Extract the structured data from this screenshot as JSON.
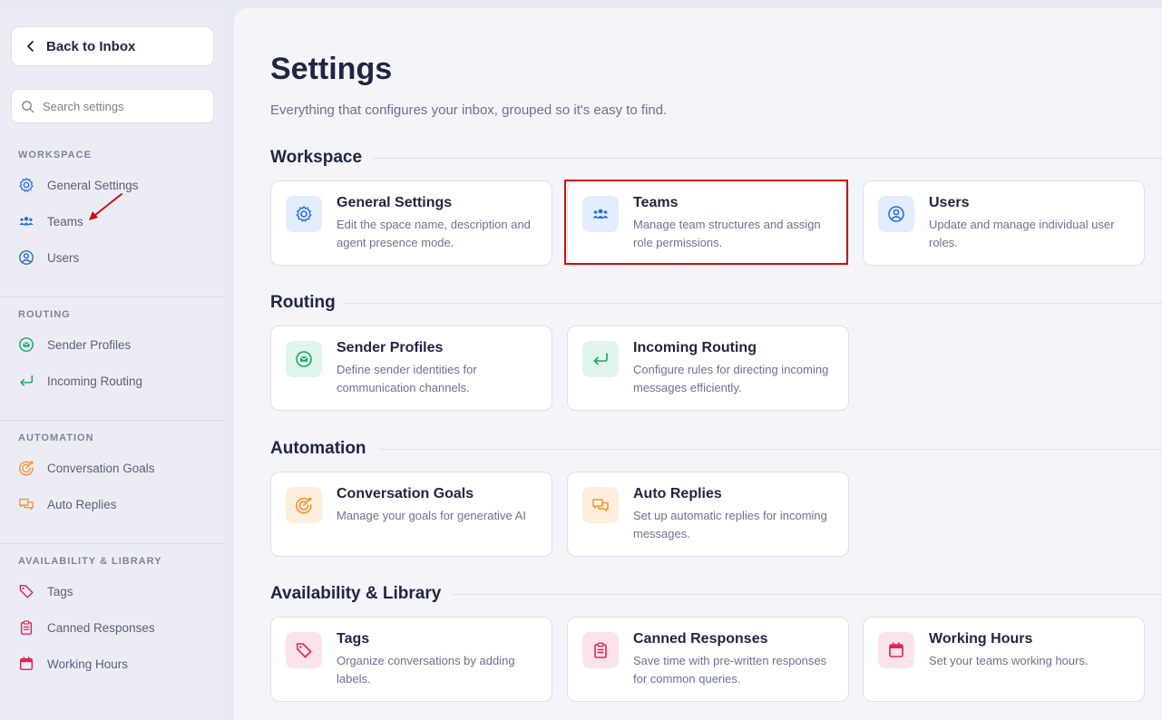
{
  "sidebar": {
    "back_label": "Back to Inbox",
    "search_placeholder": "Search settings",
    "groups": [
      {
        "title": "WORKSPACE",
        "items": [
          "General Settings",
          "Teams",
          "Users"
        ]
      },
      {
        "title": "ROUTING",
        "items": [
          "Sender Profiles",
          "Incoming Routing"
        ]
      },
      {
        "title": "AUTOMATION",
        "items": [
          "Conversation Goals",
          "Auto Replies"
        ]
      },
      {
        "title": "AVAILABILITY & LIBRARY",
        "items": [
          "Tags",
          "Canned Responses",
          "Working Hours"
        ]
      }
    ]
  },
  "main": {
    "title": "Settings",
    "subtitle": "Everything that configures your inbox, grouped so it's easy to find.",
    "sections": [
      {
        "title": "Workspace",
        "cards": [
          {
            "title": "General Settings",
            "desc": "Edit the space name, description and agent presence mode."
          },
          {
            "title": "Teams",
            "desc": "Manage team structures and assign role permissions."
          },
          {
            "title": "Users",
            "desc": "Update and manage individual user roles."
          }
        ]
      },
      {
        "title": "Routing",
        "cards": [
          {
            "title": "Sender Profiles",
            "desc": "Define sender identities for communication channels."
          },
          {
            "title": "Incoming Routing",
            "desc": "Configure rules for directing incoming messages efficiently."
          }
        ]
      },
      {
        "title": "Automation",
        "cards": [
          {
            "title": "Conversation Goals",
            "desc": "Manage your goals for generative AI"
          },
          {
            "title": "Auto Replies",
            "desc": "Set up automatic replies for incoming messages."
          }
        ]
      },
      {
        "title": "Availability & Library",
        "cards": [
          {
            "title": "Tags",
            "desc": "Organize conversations by adding labels."
          },
          {
            "title": "Canned Responses",
            "desc": "Save time with pre-written responses for common queries."
          },
          {
            "title": "Working Hours",
            "desc": "Set your teams working hours."
          }
        ]
      }
    ]
  },
  "colors": {
    "blue": "#2a6fdb",
    "blue_bg": "#e3edfc",
    "green": "#1aa36b",
    "green_bg": "#e0f5ec",
    "orange": "#f0953a",
    "orange_bg": "#fdeedd",
    "pink": "#e2245b",
    "pink_bg": "#fde3ea",
    "highlight": "#d40e0e"
  },
  "icons": {
    "back": "chevron-left-icon",
    "search": "search-icon",
    "general": "gear-icon",
    "teams": "team-icon",
    "users": "user-circle-icon",
    "sender": "envelope-circle-icon",
    "incoming": "return-arrow-icon",
    "goals": "target-icon",
    "auto_replies": "chat-bubbles-icon",
    "tags": "tag-icon",
    "canned": "clipboard-icon",
    "hours": "calendar-icon"
  }
}
